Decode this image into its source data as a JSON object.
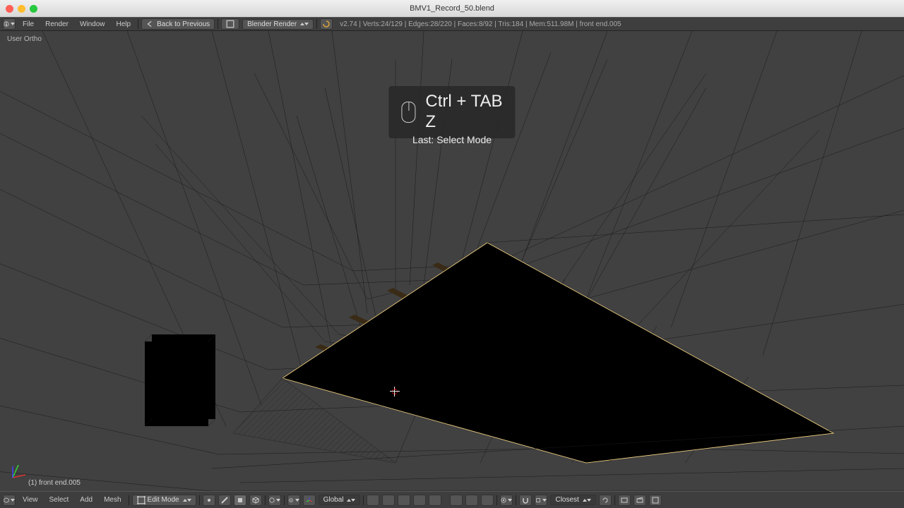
{
  "window": {
    "title": "BMV1_Record_50.blend"
  },
  "topbar": {
    "menus": {
      "file": "File",
      "render": "Render",
      "window": "Window",
      "help": "Help"
    },
    "back_to_previous": "Back to Previous",
    "engine": "Blender Render",
    "stats": "v2.74 | Verts:24/129 | Edges:28/220 | Faces:8/92 | Tris:184 | Mem:511.98M | front end.005"
  },
  "viewport": {
    "projection": "User Ortho",
    "object_label": "(1) front end.005"
  },
  "overlay": {
    "key1": "Ctrl + TAB",
    "key2": "Z",
    "last": "Last: Select Mode"
  },
  "bottombar": {
    "view": "View",
    "select": "Select",
    "add": "Add",
    "mesh": "Mesh",
    "mode": "Edit Mode",
    "orientation": "Global",
    "snap_target": "Closest"
  }
}
